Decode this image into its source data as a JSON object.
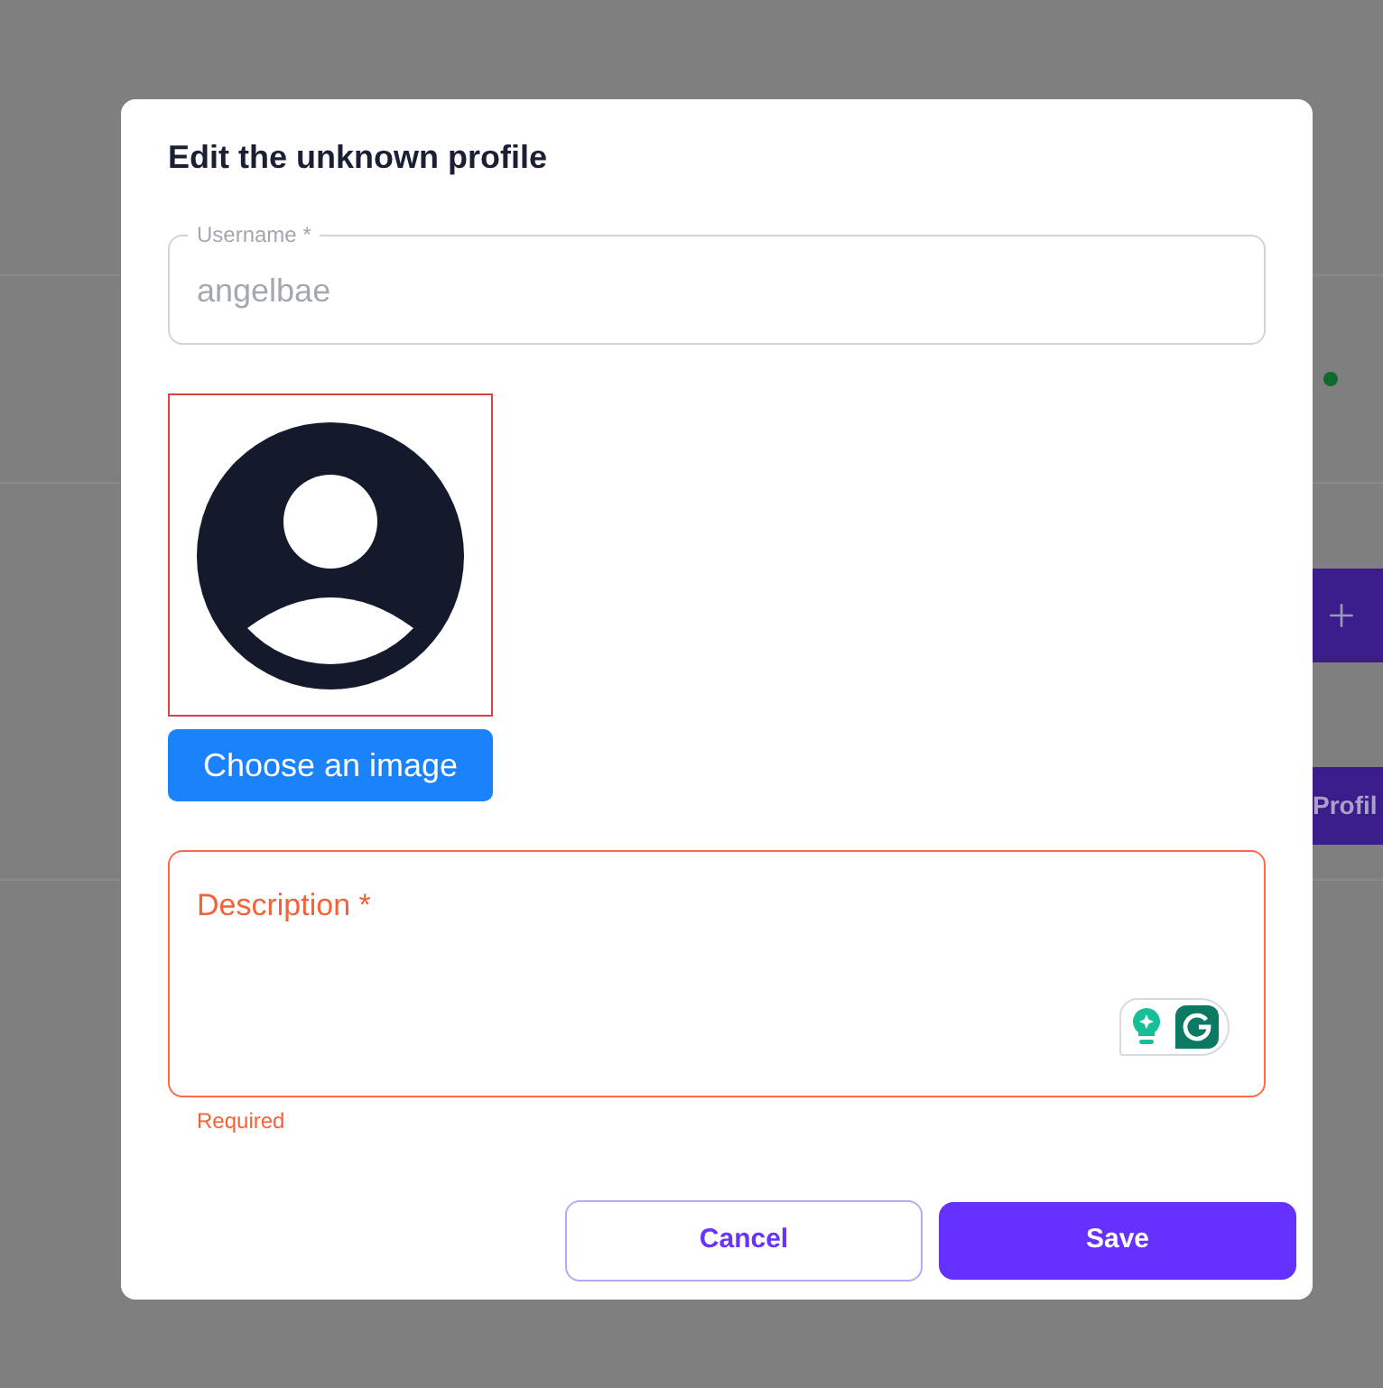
{
  "dialog": {
    "title": "Edit the unknown profile",
    "username_field": {
      "label": "Username *",
      "value": "angelbae",
      "disabled": true
    },
    "image_picker": {
      "button": "Choose an image"
    },
    "description_field": {
      "label": "Description *",
      "error": true,
      "helper_text": "Required"
    },
    "actions": [
      {
        "label": "Cancel",
        "kind": "outline"
      },
      {
        "label": "Save",
        "kind": "primary"
      }
    ]
  },
  "background": {
    "profile_button": {
      "label": "Profil"
    }
  }
}
